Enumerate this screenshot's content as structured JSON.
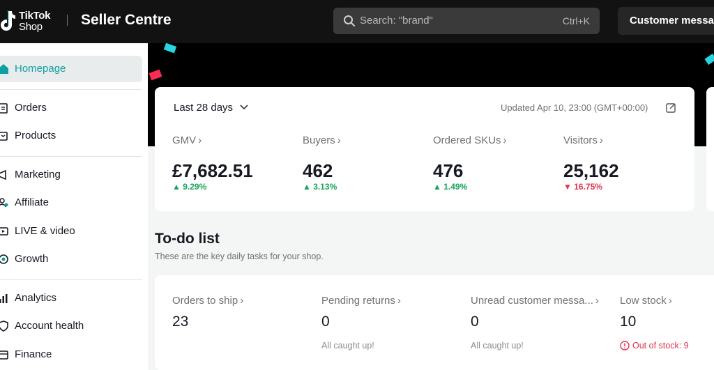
{
  "header": {
    "logo_line1": "TikTok",
    "logo_line2": "Shop",
    "title": "Seller Centre",
    "search_placeholder": "Search: \"brand\"",
    "search_shortcut": "Ctrl+K",
    "customer_button": "Customer messages"
  },
  "sidebar": {
    "items": [
      {
        "label": "Homepage",
        "icon": "home-icon",
        "active": true
      },
      {
        "label": "Orders",
        "icon": "clipboard-icon"
      },
      {
        "label": "Products",
        "icon": "box-icon"
      },
      {
        "label": "Marketing",
        "icon": "megaphone-icon"
      },
      {
        "label": "Affiliate",
        "icon": "people-icon"
      },
      {
        "label": "LIVE & video",
        "icon": "video-icon"
      },
      {
        "label": "Growth",
        "icon": "growth-icon"
      },
      {
        "label": "Analytics",
        "icon": "bar-chart-icon"
      },
      {
        "label": "Account health",
        "icon": "shield-icon"
      },
      {
        "label": "Finance",
        "icon": "wallet-icon"
      }
    ]
  },
  "stats": {
    "range": "Last 28 days",
    "updated": "Updated Apr 10, 23:00 (GMT+00:00)",
    "metrics": [
      {
        "label": "GMV",
        "value": "£7,682.51",
        "change": "9.29%",
        "direction": "up"
      },
      {
        "label": "Buyers",
        "value": "462",
        "change": "3.13%",
        "direction": "up"
      },
      {
        "label": "Ordered SKUs",
        "value": "476",
        "change": "1.49%",
        "direction": "up"
      },
      {
        "label": "Visitors",
        "value": "25,162",
        "change": "16.75%",
        "direction": "down"
      }
    ]
  },
  "todo": {
    "title": "To-do list",
    "subtitle": "These are the key daily tasks for your shop.",
    "items": [
      {
        "label": "Orders to ship",
        "value": "23",
        "note": ""
      },
      {
        "label": "Pending returns",
        "value": "0",
        "note": "All caught up!"
      },
      {
        "label": "Unread customer messa...",
        "value": "0",
        "note": "All caught up!"
      },
      {
        "label": "Low stock",
        "value": "10",
        "note": "Out of stock: 9"
      }
    ]
  },
  "colors": {
    "accent": "#0e9fa0",
    "up": "#1aa35a",
    "down": "#e0344e",
    "topbar": "#121212"
  }
}
